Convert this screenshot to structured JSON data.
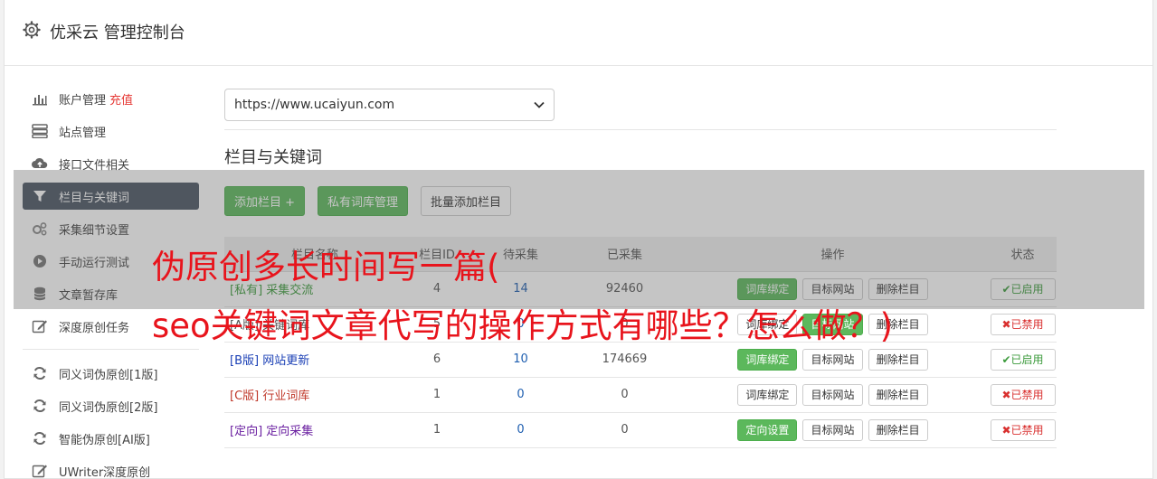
{
  "header": {
    "title": "优采云 管理控制台",
    "icon": "gear-icon"
  },
  "sidebar": {
    "items": [
      {
        "label": "账户管理",
        "extra": "充值",
        "icon": "bar-chart-icon"
      },
      {
        "label": "站点管理",
        "icon": "server-icon"
      },
      {
        "label": "接口文件相关",
        "icon": "cloud-upload-icon"
      },
      {
        "label": "栏目与关键词",
        "icon": "filter-icon",
        "active": true
      },
      {
        "label": "采集细节设置",
        "icon": "cogs-icon"
      },
      {
        "label": "手动运行测试",
        "icon": "play-circle-icon"
      },
      {
        "label": "文章暂存库",
        "icon": "database-icon"
      },
      {
        "label": "深度原创任务",
        "icon": "edit-icon"
      }
    ],
    "items2": [
      {
        "label": "同义词伪原创[1版]",
        "icon": "refresh-icon"
      },
      {
        "label": "同义词伪原创[2版]",
        "icon": "refresh-icon"
      },
      {
        "label": "智能伪原创[AI版]",
        "icon": "refresh-icon"
      },
      {
        "label": "UWriter深度原创",
        "icon": "edit-icon"
      }
    ]
  },
  "main": {
    "site_select": "https://www.ucaiyun.com",
    "section_title": "栏目与关键词",
    "buttons": {
      "add": "添加栏目 +",
      "private": "私有词库管理",
      "batch": "批量添加栏目"
    },
    "table": {
      "headers": [
        "栏目名称",
        "栏目ID",
        "待采集",
        "已采集",
        "操作",
        "状态"
      ],
      "rows": [
        {
          "name": "[私有] 采集交流",
          "id": "4",
          "pending": "14",
          "done": "92460",
          "op1": "词库绑定",
          "op1_green": true,
          "op2": "目标网站",
          "op2_green": false,
          "op3": "删除栏目",
          "status": "✔已启用",
          "status_on": true,
          "color": "green"
        },
        {
          "name": "[A版] 关键词库",
          "id": "5",
          "pending": "0",
          "done": "0",
          "op1": "词库绑定",
          "op1_green": false,
          "op2": "目标网站",
          "op2_green": true,
          "op3": "删除栏目",
          "status": "✖已禁用",
          "status_on": false,
          "color": "dark"
        },
        {
          "name": "[B版] 网站更新",
          "id": "6",
          "pending": "10",
          "done": "174669",
          "op1": "词库绑定",
          "op1_green": true,
          "op2": "目标网站",
          "op2_green": false,
          "op3": "删除栏目",
          "status": "✔已启用",
          "status_on": true,
          "color": "blue"
        },
        {
          "name": "[C版] 行业词库",
          "id": "1",
          "pending": "0",
          "done": "0",
          "op1": "词库绑定",
          "op1_green": false,
          "op2": "目标网站",
          "op2_green": false,
          "op3": "删除栏目",
          "status": "✖已禁用",
          "status_on": false,
          "color": "red"
        },
        {
          "name": "[定向] 定向采集",
          "id": "1",
          "pending": "0",
          "done": "0",
          "op1": "定向设置",
          "op1_green": true,
          "op2": "目标网站",
          "op2_green": false,
          "op3": "删除栏目",
          "status": "✖已禁用",
          "status_on": false,
          "color": "purple"
        }
      ]
    }
  },
  "overlay": {
    "line1": "伪原创多长时间写一篇(",
    "line2": "seo关键词文章代写的操作方式有哪些？怎么做？)"
  }
}
